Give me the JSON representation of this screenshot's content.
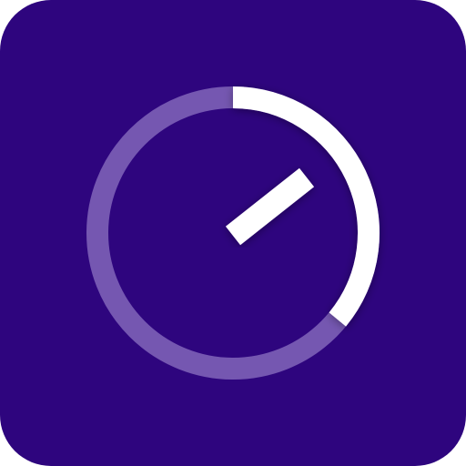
{
  "app_icon": {
    "icon_name": "speedometer-icon",
    "colors": {
      "background": "#2e057e",
      "track": "#7557b1",
      "progress_arc": "#ffffff",
      "needle": "#ffffff"
    },
    "progress_fraction": 0.36
  }
}
